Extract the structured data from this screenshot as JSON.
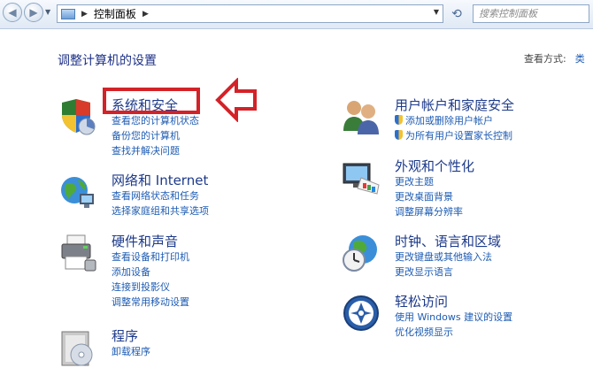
{
  "toolbar": {
    "breadcrumb": "控制面板",
    "search_placeholder": "搜索控制面板"
  },
  "header": {
    "title": "调整计算机的设置",
    "view_by_label": "查看方式:",
    "view_by_value": "类"
  },
  "annotation_color": "#d32228",
  "categories_left": [
    {
      "name": "系统和安全",
      "icon": "shield-icon",
      "links": [
        "查看您的计算机状态",
        "备份您的计算机",
        "查找并解决问题"
      ]
    },
    {
      "name": "网络和 Internet",
      "icon": "network-globe-icon",
      "links": [
        "查看网络状态和任务",
        "选择家庭组和共享选项"
      ]
    },
    {
      "name": "硬件和声音",
      "icon": "printer-icon",
      "links": [
        "查看设备和打印机",
        "添加设备",
        "连接到投影仪",
        "调整常用移动设置"
      ]
    },
    {
      "name": "程序",
      "icon": "programs-icon",
      "links": [
        "卸载程序"
      ]
    }
  ],
  "categories_right": [
    {
      "name": "用户帐户和家庭安全",
      "icon": "users-icon",
      "links": [
        "添加或删除用户帐户",
        "为所有用户设置家长控制"
      ]
    },
    {
      "name": "外观和个性化",
      "icon": "monitor-palette-icon",
      "links": [
        "更改主题",
        "更改桌面背景",
        "调整屏幕分辨率"
      ]
    },
    {
      "name": "时钟、语言和区域",
      "icon": "clock-globe-icon",
      "links": [
        "更改键盘或其他输入法",
        "更改显示语言"
      ]
    },
    {
      "name": "轻松访问",
      "icon": "ease-of-access-icon",
      "links": [
        "使用 Windows 建议的设置",
        "优化视频显示"
      ]
    }
  ]
}
